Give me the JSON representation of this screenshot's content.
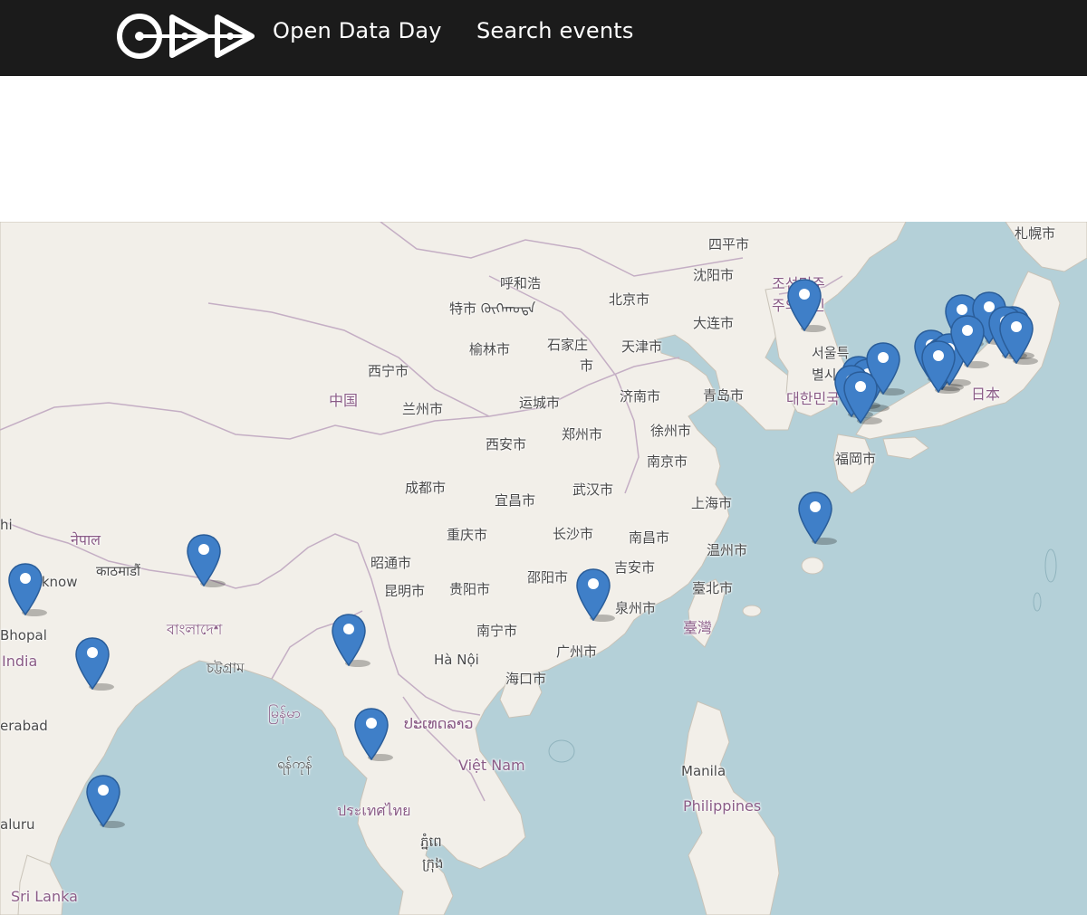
{
  "navbar": {
    "logo_icon": "odd-logo-icon",
    "home_label": "Open Data Day",
    "search_label": "Search events"
  },
  "map": {
    "colors": {
      "land": "#f2efe9",
      "water": "#b4d0d8",
      "border": "#b69ab5",
      "marker": "#3f7fc8"
    },
    "labels": {
      "siping": "四平市",
      "sapporo": "札幌市",
      "hohhot": "呼和浩",
      "baotou": "特市 ᠬᠥᠬᠡᠬᠣᠲᠠ",
      "beijing": "北京市",
      "shenyang": "沈阳市",
      "nk1": "조선민주",
      "nk2": "주의인민",
      "dalian": "大连市",
      "yulin": "榆林市",
      "shijiazhuang1": "石家庄",
      "shijiazhuang2": "市",
      "tianjin": "天津市",
      "seoul1": "서울특",
      "seoul2": "별시",
      "xining": "西宁市",
      "china": "中国",
      "lanzhou": "兰州市",
      "yuncheng": "运城市",
      "jinan": "济南市",
      "qingdao": "青岛市",
      "korea": "대한민국",
      "japan": "日本",
      "xian": "西安市",
      "zhengzhou": "郑州市",
      "xuzhou": "徐州市",
      "fukuoka": "福岡市",
      "nanjing": "南京市",
      "chengdu": "成都市",
      "yichang": "宜昌市",
      "wuhan": "武汉市",
      "shanghai": "上海市",
      "nepal": "नेपाल",
      "chongqing": "重庆市",
      "changsha": "长沙市",
      "nanchang": "南昌市",
      "kathmandu": "काठमाडौं",
      "wenzhou": "温州市",
      "lucknow": "Lucknow",
      "zhaotong": "昭通市",
      "kunming": "昆明市",
      "guiyang": "贵阳市",
      "shaoyang": "邵阳市",
      "jian": "吉安市",
      "taipei": "臺北市",
      "quanzhou": "泉州市",
      "taiwan": "臺灣",
      "bhopal": "Bhopal",
      "bangladesh": "বাংলাদেশ",
      "nanning": "南宁市",
      "india": "India",
      "guangzhou": "广州市",
      "hanoi": "Hà Nội",
      "chittagong": "চট্টগ্রাম",
      "haikou": "海口市",
      "myanmar": "မြန်မာ",
      "laos": "ປະເທດລາວ",
      "hyderabad": "erabad",
      "yangon": "ရန်ကုန်",
      "vietnam": "Việt Nam",
      "manila": "Manila",
      "philippines": "Philippines",
      "thailand": "ประเทศไทย",
      "bengaluru": "aluru",
      "phnompenh1": "ភ្នំពេ",
      "phnompenh2": "ក្រុង",
      "srilanka": "Sri Lanka",
      "delhi_partial": "hi"
    },
    "marker_count": 24
  }
}
